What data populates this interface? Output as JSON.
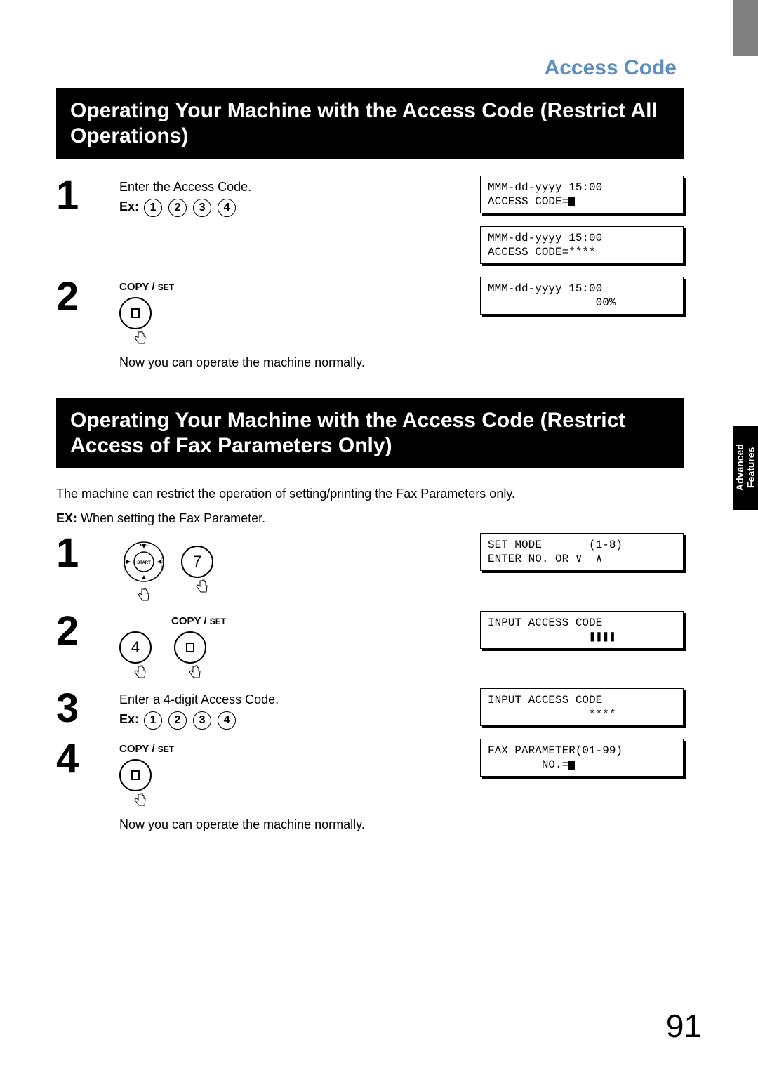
{
  "side_tab": {
    "label": "Advanced\nFeatures"
  },
  "chapter": "Access Code",
  "section1": {
    "heading": "Operating Your Machine with the Access Code (Restrict All Operations)",
    "step1": {
      "text": "Enter the Access Code.",
      "ex_label": "Ex:",
      "keys": [
        "1",
        "2",
        "3",
        "4"
      ]
    },
    "lcd1_line1": "MMM-dd-yyyy 15:00",
    "lcd1_line2": "ACCESS CODE=",
    "lcd2_line1": "MMM-dd-yyyy 15:00",
    "lcd2_line2": "ACCESS CODE=****",
    "step2": {
      "copyset": "COPY / ",
      "copyset_small": "SET",
      "after": "Now you can operate the machine normally."
    },
    "lcd3_line1": "MMM-dd-yyyy 15:00",
    "lcd3_line2": "                00%"
  },
  "section2": {
    "heading": "Operating Your Machine with the Access Code (Restrict Access of Fax Parameters Only)",
    "intro1": "The machine can restrict the operation of setting/printing the Fax Parameters only.",
    "intro2_label": "EX:",
    "intro2_text": " When setting the Fax Parameter.",
    "step1_key": "7",
    "lcd1_line1": "SET MODE       (1-8)",
    "lcd1_line2": "ENTER NO. OR ∨  ∧",
    "step2_key": "4",
    "step2_copyset": "COPY / ",
    "step2_copyset_small": "SET",
    "lcd2_line1": "INPUT ACCESS CODE",
    "lcd2_line2": "               ❚❚❚❚",
    "step3_text": "Enter a 4-digit Access Code.",
    "step3_ex_label": "Ex:",
    "step3_keys": [
      "1",
      "2",
      "3",
      "4"
    ],
    "lcd3_line1": "INPUT ACCESS CODE",
    "lcd3_line2": "               ****",
    "step4_copyset": "COPY / ",
    "step4_copyset_small": "SET",
    "step4_after": "Now you can operate the machine normally.",
    "lcd4_line1": "FAX PARAMETER(01-99)",
    "lcd4_line2": "        NO.="
  },
  "page_number": "91"
}
